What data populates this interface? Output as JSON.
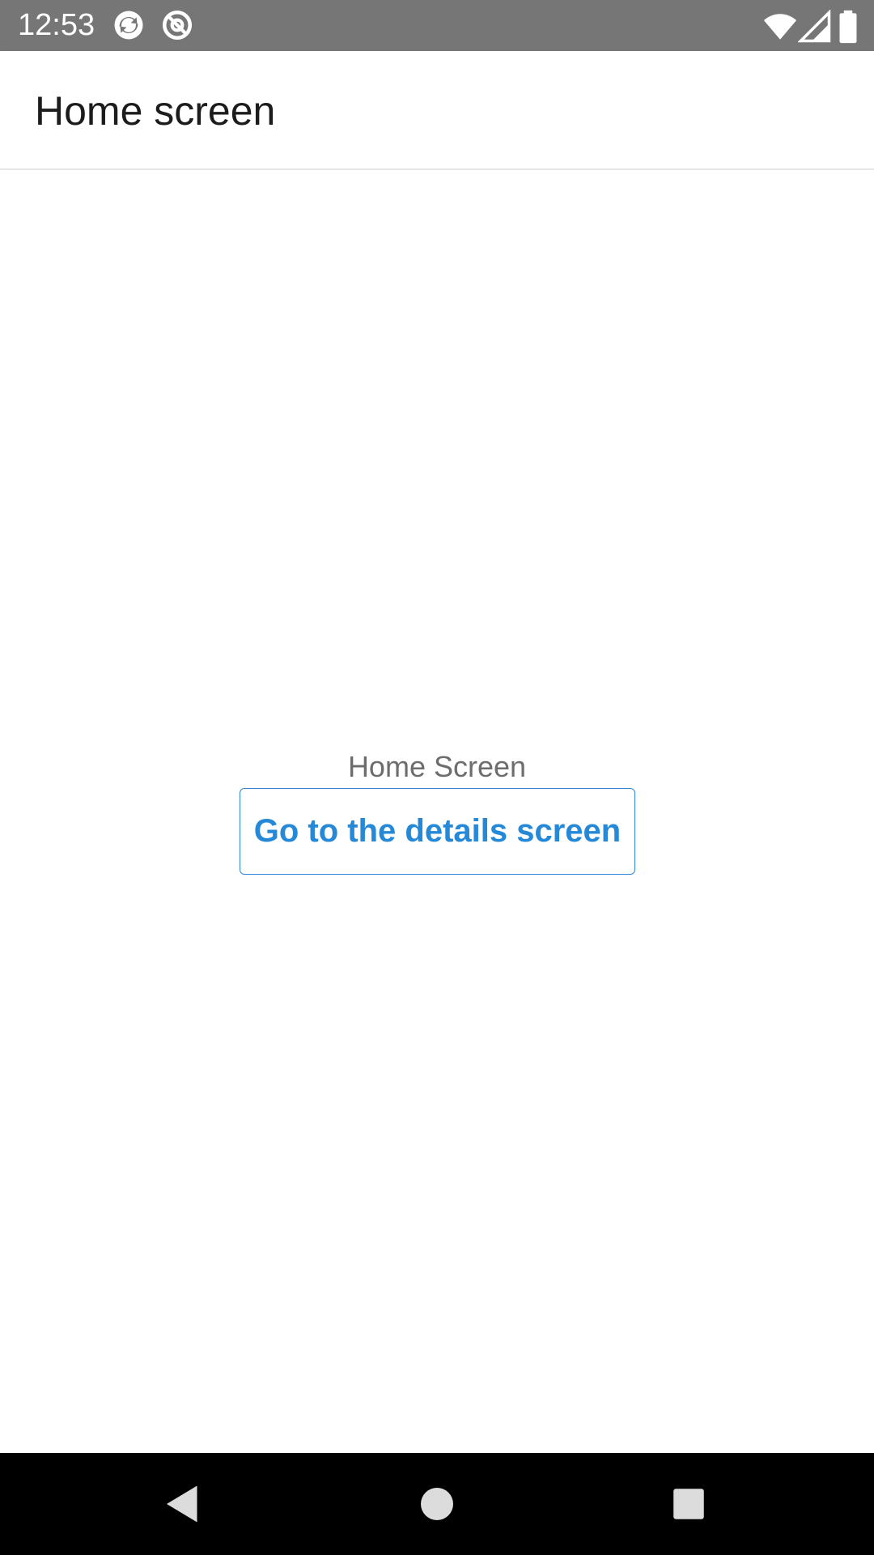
{
  "status_bar": {
    "time": "12:53",
    "icons": [
      "sync-notification-icon",
      "at-sign-notification-icon",
      "wifi-icon",
      "cellular-signal-icon",
      "battery-icon"
    ]
  },
  "app_bar": {
    "title": "Home screen"
  },
  "main": {
    "label": "Home Screen",
    "button_label": "Go to the details screen"
  },
  "nav_bar": {
    "icons": [
      "back-icon",
      "home-icon",
      "recents-icon"
    ]
  },
  "colors": {
    "status_bar": "#767676",
    "accent": "#2589d8",
    "label_text": "#6d6d6d",
    "nav_bar": "#000000"
  }
}
